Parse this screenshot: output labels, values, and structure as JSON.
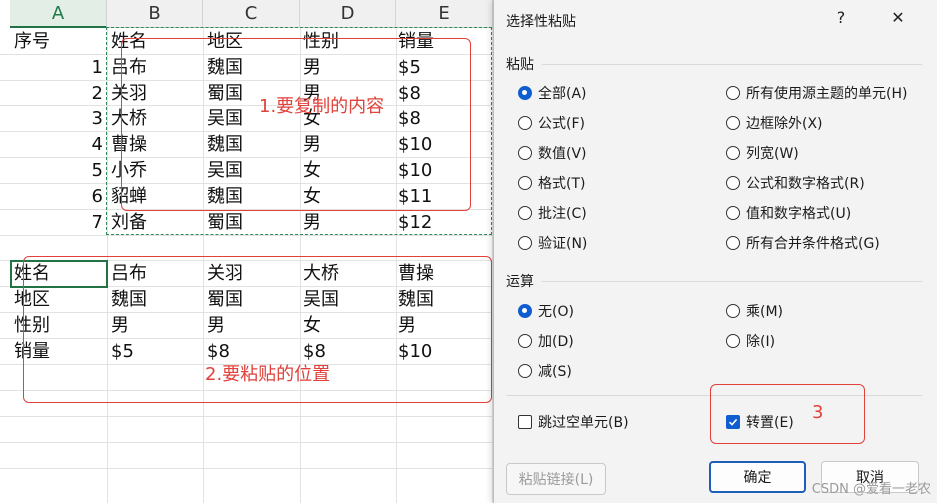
{
  "sheet": {
    "col_headers": [
      "A",
      "B",
      "C",
      "D",
      "E"
    ],
    "source": {
      "header": [
        "序号",
        "姓名",
        "地区",
        "性别",
        "销量"
      ],
      "rows": [
        [
          "1",
          "吕布",
          "魏国",
          "男",
          "$5"
        ],
        [
          "2",
          "关羽",
          "蜀国",
          "男",
          "$8"
        ],
        [
          "3",
          "大桥",
          "吴国",
          "女",
          "$8"
        ],
        [
          "4",
          "曹操",
          "魏国",
          "男",
          "$10"
        ],
        [
          "5",
          "小乔",
          "吴国",
          "女",
          "$10"
        ],
        [
          "6",
          "貂蝉",
          "魏国",
          "女",
          "$11"
        ],
        [
          "7",
          "刘备",
          "蜀国",
          "男",
          "$12"
        ]
      ]
    },
    "pasted": [
      [
        "姓名",
        "吕布",
        "关羽",
        "大桥",
        "曹操"
      ],
      [
        "地区",
        "魏国",
        "蜀国",
        "吴国",
        "魏国"
      ],
      [
        "性别",
        "男",
        "男",
        "女",
        "男"
      ],
      [
        "销量",
        "$5",
        "$8",
        "$8",
        "$10"
      ]
    ],
    "annotations": {
      "copy_label": "1.要复制的内容",
      "paste_label": "2.要粘贴的位置",
      "step3_label": "3"
    },
    "colors": {
      "annotation": "#e0413a",
      "marquee": "#2f8a57"
    }
  },
  "dialog": {
    "title": "选择性粘贴",
    "help": "?",
    "close": "✕",
    "paste_section": "粘贴",
    "paste_options_left": [
      {
        "label": "全部(A)",
        "checked": true
      },
      {
        "label": "公式(F)",
        "checked": false
      },
      {
        "label": "数值(V)",
        "checked": false
      },
      {
        "label": "格式(T)",
        "checked": false
      },
      {
        "label": "批注(C)",
        "checked": false
      },
      {
        "label": "验证(N)",
        "checked": false
      }
    ],
    "paste_options_right": [
      {
        "label": "所有使用源主题的单元(H)",
        "checked": false
      },
      {
        "label": "边框除外(X)",
        "checked": false
      },
      {
        "label": "列宽(W)",
        "checked": false
      },
      {
        "label": "公式和数字格式(R)",
        "checked": false
      },
      {
        "label": "值和数字格式(U)",
        "checked": false
      },
      {
        "label": "所有合并条件格式(G)",
        "checked": false
      }
    ],
    "op_section": "运算",
    "op_options_left": [
      {
        "label": "无(O)",
        "checked": true
      },
      {
        "label": "加(D)",
        "checked": false
      },
      {
        "label": "减(S)",
        "checked": false
      }
    ],
    "op_options_right": [
      {
        "label": "乘(M)",
        "checked": false
      },
      {
        "label": "除(I)",
        "checked": false
      }
    ],
    "skip_blanks": {
      "label": "跳过空单元(B)",
      "checked": false
    },
    "transpose": {
      "label": "转置(E)",
      "checked": true
    },
    "paste_link": "粘贴链接(L)",
    "ok": "确定",
    "cancel": "取消",
    "accent": "#0f5ed1"
  },
  "watermark": "CSDN @爱看一老农"
}
